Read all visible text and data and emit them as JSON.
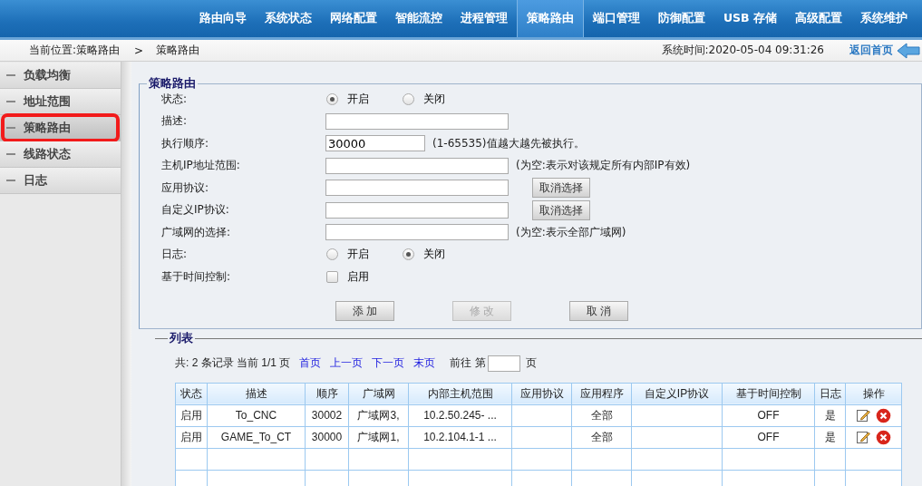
{
  "top_nav": [
    {
      "label": "路由向导",
      "selected": false
    },
    {
      "label": "系统状态",
      "selected": false
    },
    {
      "label": "网络配置",
      "selected": false
    },
    {
      "label": "智能流控",
      "selected": false
    },
    {
      "label": "进程管理",
      "selected": false
    },
    {
      "label": "策略路由",
      "selected": true
    },
    {
      "label": "端口管理",
      "selected": false
    },
    {
      "label": "防御配置",
      "selected": false
    },
    {
      "label": "USB 存储",
      "selected": false
    },
    {
      "label": "高级配置",
      "selected": false
    },
    {
      "label": "系统维护",
      "selected": false
    }
  ],
  "breadcrumb": {
    "location": "当前位置:策略路由",
    "separator": ">",
    "current": "策略路由",
    "system_time": "系统时间:2020-05-04 09:31:26",
    "home_link": "返回首页"
  },
  "sidebar": {
    "items": [
      {
        "label": "负载均衡",
        "selected": false,
        "highlighted": false
      },
      {
        "label": "地址范围",
        "selected": false,
        "highlighted": false
      },
      {
        "label": "策略路由",
        "selected": true,
        "highlighted": true
      },
      {
        "label": "线路状态",
        "selected": false,
        "highlighted": false
      },
      {
        "label": "日志",
        "selected": false,
        "highlighted": false
      }
    ]
  },
  "form": {
    "title": "策略路由",
    "rows": [
      {
        "kind": "radio",
        "label": "状态:",
        "options": [
          {
            "label": "开启",
            "selected": true
          },
          {
            "label": "关闭",
            "selected": false
          }
        ]
      },
      {
        "kind": "text",
        "label": "描述:"
      },
      {
        "kind": "number",
        "label": "执行顺序:",
        "value": "30000",
        "hint": "(1-65535)值越大越先被执行。"
      },
      {
        "kind": "text",
        "label": "主机IP地址范围:",
        "hint": "(为空:表示对该规定所有内部IP有效)"
      },
      {
        "kind": "text",
        "label": "应用协议:",
        "button": "取消选择"
      },
      {
        "kind": "text",
        "label": "自定义IP协议:",
        "button": "取消选择"
      },
      {
        "kind": "text",
        "label": "广域网的选择:",
        "hint": "(为空:表示全部广域网)"
      },
      {
        "kind": "radio",
        "label": "日志:",
        "options": [
          {
            "label": "开启",
            "selected": false
          },
          {
            "label": "关闭",
            "selected": true
          }
        ]
      },
      {
        "kind": "checkbox",
        "label": "基于时间控制:",
        "option": "启用",
        "checked": false
      }
    ],
    "buttons": [
      {
        "label": "添 加",
        "disabled": false
      },
      {
        "label": "修 改",
        "disabled": true
      },
      {
        "label": "取 消",
        "disabled": false
      }
    ]
  },
  "list": {
    "title": "列表",
    "summary": "共: 2 条记录 当前 1/1 页",
    "page_links": [
      "首页",
      "上一页",
      "下一页",
      "末页"
    ],
    "goto_prefix": "前往 第",
    "goto_suffix": "页",
    "columns": [
      "状态",
      "描述",
      "顺序",
      "广域网",
      "内部主机范围",
      "应用协议",
      "应用程序",
      "自定义IP协议",
      "基于时间控制",
      "日志",
      "操作"
    ],
    "rows": [
      {
        "cells": [
          "启用",
          "To_CNC",
          "30002",
          "广域网3,",
          "10.2.50.245- ...",
          "",
          "全部",
          "",
          "OFF",
          "是"
        ]
      },
      {
        "cells": [
          "启用",
          "GAME_To_CT",
          "30000",
          "广域网1,",
          "10.2.104.1-1 ...",
          "",
          "全部",
          "",
          "OFF",
          "是"
        ]
      }
    ]
  }
}
